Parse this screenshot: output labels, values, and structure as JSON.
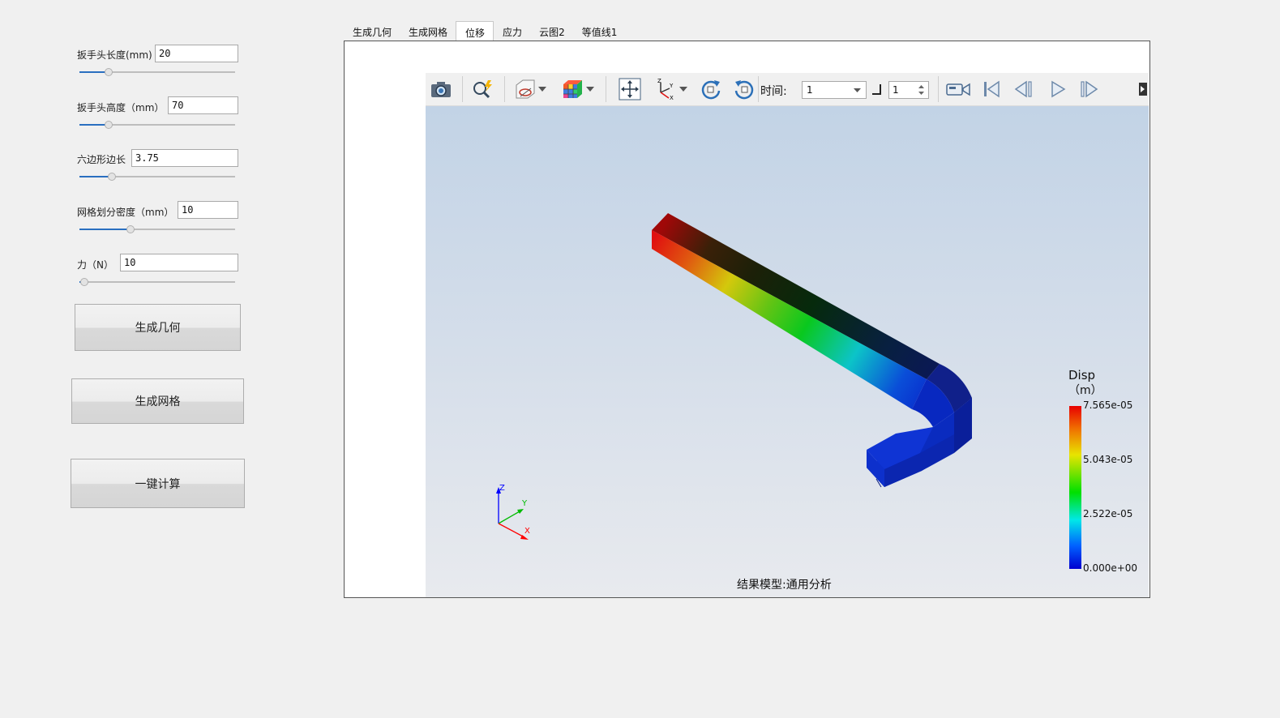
{
  "params": [
    {
      "label": "扳手头长度(mm)",
      "value": "20",
      "slider": 0.19
    },
    {
      "label": "扳手头高度（mm）",
      "value": "70",
      "slider": 0.19
    },
    {
      "label": "六边形边长",
      "value": "3.75",
      "slider": 0.21
    },
    {
      "label": "网格划分密度（mm）",
      "value": "10",
      "slider": 0.33
    },
    {
      "label": "力（N）",
      "value": "10",
      "slider": 0.03
    }
  ],
  "buttons": {
    "geometry": "生成几何",
    "mesh": "生成网格",
    "compute": "一键计算"
  },
  "tabs": [
    "生成几何",
    "生成网格",
    "位移",
    "应力",
    "云图2",
    "等值线1"
  ],
  "active_tab": "位移",
  "toolbar": {
    "time_label": "时间:",
    "time_value": "1",
    "step_value": "1"
  },
  "legend": {
    "title": "Disp",
    "unit": "（m）",
    "ticks": [
      "7.565e-05",
      "5.043e-05",
      "2.522e-05",
      "0.000e+00"
    ]
  },
  "axes": {
    "x": "X",
    "y": "Y",
    "z": "Z"
  },
  "footer": "结果模型:通用分析",
  "colors": {
    "accent": "#2a6fc0"
  }
}
